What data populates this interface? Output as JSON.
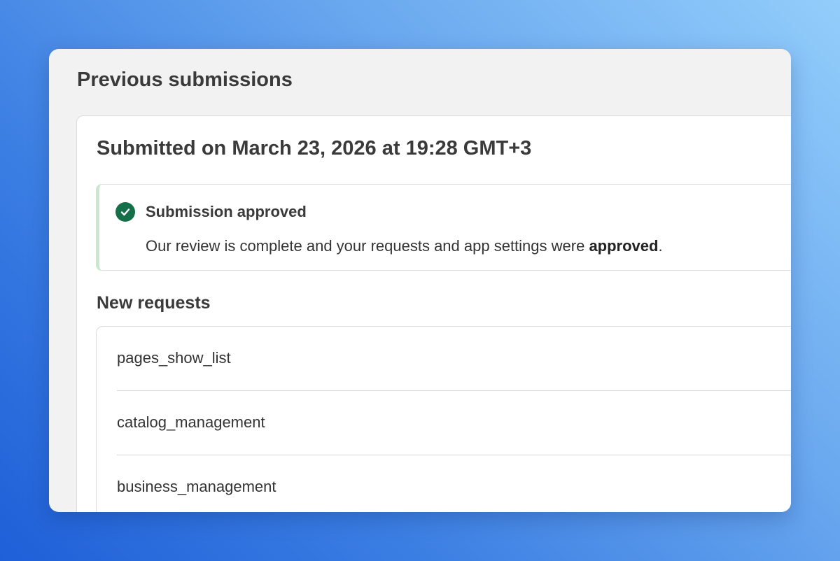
{
  "header": {
    "title": "Previous submissions"
  },
  "submission": {
    "title": "Submitted on March 23, 2026 at 19:28 GMT+3",
    "status": {
      "icon": "check-circle-icon",
      "color": "#15704a",
      "border_color": "#c9e8cf",
      "title": "Submission approved",
      "message_prefix": "Our review is complete and your requests and app settings were ",
      "message_emphasis": "approved",
      "message_suffix": "."
    },
    "requests_title": "New requests",
    "requests": [
      {
        "label": "pages_show_list"
      },
      {
        "label": "catalog_management"
      },
      {
        "label": "business_management"
      }
    ]
  }
}
